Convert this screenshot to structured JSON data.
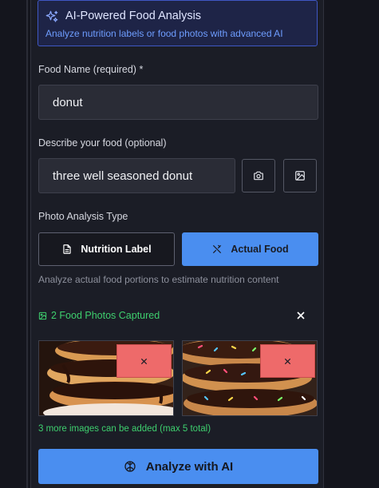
{
  "banner": {
    "icon": "sparkles-icon",
    "title": "AI-Powered Food Analysis",
    "subtitle": "Analyze nutrition labels or food photos with advanced AI"
  },
  "food_name": {
    "label": "Food Name (required) *",
    "value": "donut"
  },
  "description": {
    "label": "Describe your food (optional)",
    "value": "three well seasoned donut",
    "camera_icon": "camera-icon",
    "gallery_icon": "image-icon"
  },
  "photo_type": {
    "label": "Photo Analysis Type",
    "options": [
      {
        "label": "Nutrition Label",
        "icon": "document-icon",
        "selected": false
      },
      {
        "label": "Actual Food",
        "icon": "utensils-icon",
        "selected": true
      }
    ],
    "hint": "Analyze actual food portions to estimate nutrition content"
  },
  "captured": {
    "label": "2 Food Photos Captured",
    "icon": "image-icon",
    "close_icon": "close-icon",
    "photos": [
      {
        "alt": "stacked chocolate glazed donuts"
      },
      {
        "alt": "sprinkled chocolate donuts"
      }
    ],
    "more_text": "3 more images can be added (max 5 total)"
  },
  "analyze_button": {
    "label": "Analyze with AI",
    "icon": "brain-icon"
  },
  "colors": {
    "accent": "#4a8ef0",
    "success": "#3ecf6e",
    "danger": "#ee6a6a",
    "banner_border": "#3f57c4"
  }
}
